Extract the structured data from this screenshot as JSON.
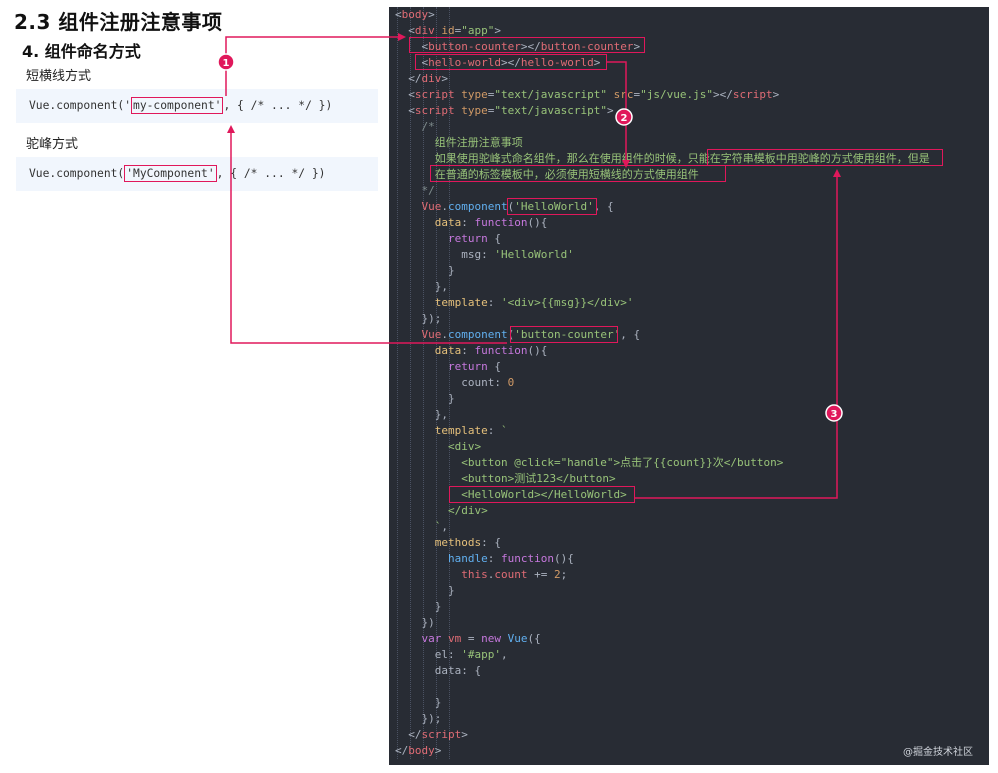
{
  "doc": {
    "title": "2.3 组件注册注意事项",
    "subtitle": "4.  组件命名方式",
    "kebab_label": "短横线方式",
    "kebab_code_pre": "Vue.component('",
    "kebab_code_hl": "my-component'",
    "kebab_code_post": ", { /* ... */ })",
    "camel_label": "驼峰方式",
    "camel_code_pre": "Vue.component(",
    "camel_code_hl": "'MyComponent'",
    "camel_code_post": ", { /* ... */ })"
  },
  "badges": [
    "1",
    "2",
    "3"
  ],
  "watermark": "@掘金技术社区",
  "code_lines": [
    [
      [
        "t-pl",
        "<"
      ],
      [
        "t-tag",
        "body"
      ],
      [
        "t-pl",
        ">"
      ]
    ],
    [
      [
        "t-pl",
        "  <"
      ],
      [
        "t-tag",
        "div"
      ],
      [
        "t-attr",
        " id"
      ],
      [
        "t-pl",
        "="
      ],
      [
        "t-str",
        "\"app\""
      ],
      [
        "t-pl",
        ">"
      ]
    ],
    [
      [
        "t-pl",
        "    <"
      ],
      [
        "t-tag",
        "button-counter"
      ],
      [
        "t-pl",
        "></"
      ],
      [
        "t-tag",
        "button-counter"
      ],
      [
        "t-pl",
        ">"
      ]
    ],
    [
      [
        "t-pl",
        "    <"
      ],
      [
        "t-tag",
        "hello-world"
      ],
      [
        "t-pl",
        "></"
      ],
      [
        "t-tag",
        "hello-world"
      ],
      [
        "t-pl",
        ">"
      ]
    ],
    [
      [
        "t-pl",
        "  </"
      ],
      [
        "t-tag",
        "div"
      ],
      [
        "t-pl",
        ">"
      ]
    ],
    [
      [
        "t-pl",
        "  <"
      ],
      [
        "t-tag",
        "script"
      ],
      [
        "t-attr",
        " type"
      ],
      [
        "t-pl",
        "="
      ],
      [
        "t-str",
        "\"text/javascript\""
      ],
      [
        "t-attr",
        " src"
      ],
      [
        "t-pl",
        "="
      ],
      [
        "t-str",
        "\"js/vue.js\""
      ],
      [
        "t-pl",
        "></"
      ],
      [
        "t-tag",
        "script"
      ],
      [
        "t-pl",
        ">"
      ]
    ],
    [
      [
        "t-pl",
        "  <"
      ],
      [
        "t-tag",
        "script"
      ],
      [
        "t-attr",
        " type"
      ],
      [
        "t-pl",
        "="
      ],
      [
        "t-str",
        "\"text/javascript\""
      ],
      [
        "t-pl",
        ">"
      ]
    ],
    [
      [
        "t-cm",
        "    /*"
      ]
    ],
    [
      [
        "t-cn",
        "      组件注册注意事项"
      ]
    ],
    [
      [
        "t-cn",
        "      如果使用驼峰式命名组件，那么在使用组件的时候，只能在字符串模板中用驼峰的方式使用组件，但是"
      ]
    ],
    [
      [
        "t-cn",
        "      在普通的标签模板中，必须使用短横线的方式使用组件"
      ]
    ],
    [
      [
        "t-cm",
        "    */"
      ]
    ],
    [
      [
        "t-pl",
        "    "
      ],
      [
        "t-prop",
        "Vue"
      ],
      [
        "t-pl",
        "."
      ],
      [
        "t-fn",
        "component"
      ],
      [
        "t-pl",
        "("
      ],
      [
        "t-str",
        "'HelloWorld'"
      ],
      [
        "t-pl",
        ", {"
      ]
    ],
    [
      [
        "t-pl",
        "      "
      ],
      [
        "t-key",
        "data"
      ],
      [
        "t-pl",
        ": "
      ],
      [
        "t-kw",
        "function"
      ],
      [
        "t-pl",
        "(){"
      ]
    ],
    [
      [
        "t-kw",
        "        return"
      ],
      [
        "t-pl",
        " {"
      ]
    ],
    [
      [
        "t-pl",
        "          "
      ],
      [
        "t-pl",
        "msg: "
      ],
      [
        "t-str",
        "'HelloWorld'"
      ]
    ],
    [
      [
        "t-pl",
        "        }"
      ]
    ],
    [
      [
        "t-pl",
        "      },"
      ]
    ],
    [
      [
        "t-pl",
        "      "
      ],
      [
        "t-key",
        "template"
      ],
      [
        "t-pl",
        ": "
      ],
      [
        "t-str",
        "'<div>{{msg}}</div>'"
      ]
    ],
    [
      [
        "t-pl",
        "    });"
      ]
    ],
    [
      [
        "t-pl",
        "    "
      ],
      [
        "t-prop",
        "Vue"
      ],
      [
        "t-pl",
        "."
      ],
      [
        "t-fn",
        "component"
      ],
      [
        "t-pl",
        "("
      ],
      [
        "t-str",
        "'button-counter'"
      ],
      [
        "t-pl",
        ", {"
      ]
    ],
    [
      [
        "t-pl",
        "      "
      ],
      [
        "t-key",
        "data"
      ],
      [
        "t-pl",
        ": "
      ],
      [
        "t-kw",
        "function"
      ],
      [
        "t-pl",
        "(){"
      ]
    ],
    [
      [
        "t-kw",
        "        return"
      ],
      [
        "t-pl",
        " {"
      ]
    ],
    [
      [
        "t-pl",
        "          count: "
      ],
      [
        "t-num",
        "0"
      ]
    ],
    [
      [
        "t-pl",
        "        }"
      ]
    ],
    [
      [
        "t-pl",
        "      },"
      ]
    ],
    [
      [
        "t-pl",
        "      "
      ],
      [
        "t-key",
        "template"
      ],
      [
        "t-pl",
        ": "
      ],
      [
        "t-str",
        "`"
      ]
    ],
    [
      [
        "t-str",
        "        <div>"
      ]
    ],
    [
      [
        "t-str",
        "          <button @click=\"handle\">点击了{{count}}次</button>"
      ]
    ],
    [
      [
        "t-str",
        "          <button>测试123</button>"
      ]
    ],
    [
      [
        "t-str",
        "          <HelloWorld></HelloWorld>"
      ]
    ],
    [
      [
        "t-str",
        "        </div>"
      ]
    ],
    [
      [
        "t-str",
        "      `"
      ],
      [
        "t-pl",
        ","
      ]
    ],
    [
      [
        "t-pl",
        "      "
      ],
      [
        "t-key",
        "methods"
      ],
      [
        "t-pl",
        ": {"
      ]
    ],
    [
      [
        "t-pl",
        "        "
      ],
      [
        "t-fn",
        "handle"
      ],
      [
        "t-pl",
        ": "
      ],
      [
        "t-kw",
        "function"
      ],
      [
        "t-pl",
        "(){"
      ]
    ],
    [
      [
        "t-pl",
        "          "
      ],
      [
        "t-prop",
        "this"
      ],
      [
        "t-pl",
        "."
      ],
      [
        "t-prop",
        "count"
      ],
      [
        "t-pl",
        " += "
      ],
      [
        "t-num",
        "2"
      ],
      [
        "t-pl",
        ";"
      ]
    ],
    [
      [
        "t-pl",
        "        }"
      ]
    ],
    [
      [
        "t-pl",
        "      }"
      ]
    ],
    [
      [
        "t-pl",
        "    })"
      ]
    ],
    [
      [
        "t-kw",
        "    var"
      ],
      [
        "t-pl",
        " "
      ],
      [
        "t-prop",
        "vm"
      ],
      [
        "t-pl",
        " = "
      ],
      [
        "t-kw",
        "new"
      ],
      [
        "t-pl",
        " "
      ],
      [
        "t-fn",
        "Vue"
      ],
      [
        "t-pl",
        "({"
      ]
    ],
    [
      [
        "t-pl",
        "      el: "
      ],
      [
        "t-str",
        "'#app'"
      ],
      [
        "t-pl",
        ","
      ]
    ],
    [
      [
        "t-pl",
        "      data: {"
      ]
    ],
    [
      [
        "t-pl",
        ""
      ]
    ],
    [
      [
        "t-pl",
        "      }"
      ]
    ],
    [
      [
        "t-pl",
        "    });"
      ]
    ],
    [
      [
        "t-pl",
        "  </"
      ],
      [
        "t-tag",
        "script"
      ],
      [
        "t-pl",
        ">"
      ]
    ],
    [
      [
        "t-pl",
        "</"
      ],
      [
        "t-tag",
        "body"
      ],
      [
        "t-pl",
        ">"
      ]
    ]
  ]
}
